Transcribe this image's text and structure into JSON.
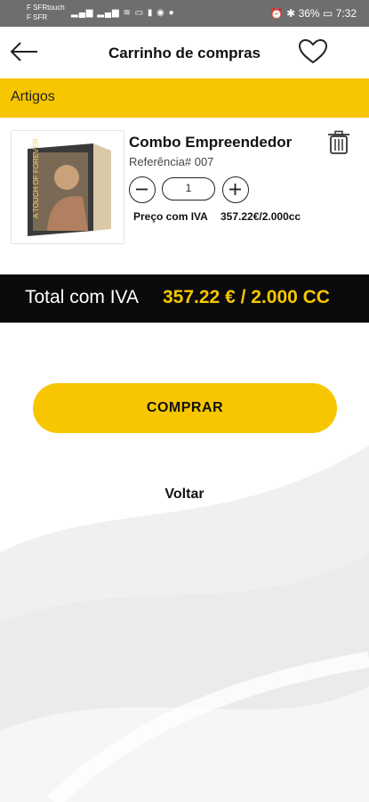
{
  "status_bar": {
    "carrier_line1": "F SFRtouch",
    "carrier_line2": "F SFR",
    "battery": "36%",
    "time": "7:32"
  },
  "header": {
    "title": "Carrinho de compras",
    "back_icon": "arrow-left-icon",
    "favorite_icon": "heart-outline-icon"
  },
  "section": {
    "label": "Artigos"
  },
  "cart_item": {
    "name": "Combo Empreendedor",
    "reference": "Referência# 007",
    "quantity": "1",
    "price_label": "Preço com IVA",
    "price_value": "357.22€/2.000cc",
    "product_image_text": "A TOUCH OF FOREVER",
    "delete_icon": "trash-icon"
  },
  "total": {
    "label": "Total com IVA",
    "value": "357.22 € / 2.000 CC"
  },
  "actions": {
    "buy_label": "COMPRAR",
    "back_label": "Voltar"
  },
  "colors": {
    "accent": "#f7c600",
    "total_bar": "#0a0a0a",
    "status_bar": "#6e6e6e"
  }
}
